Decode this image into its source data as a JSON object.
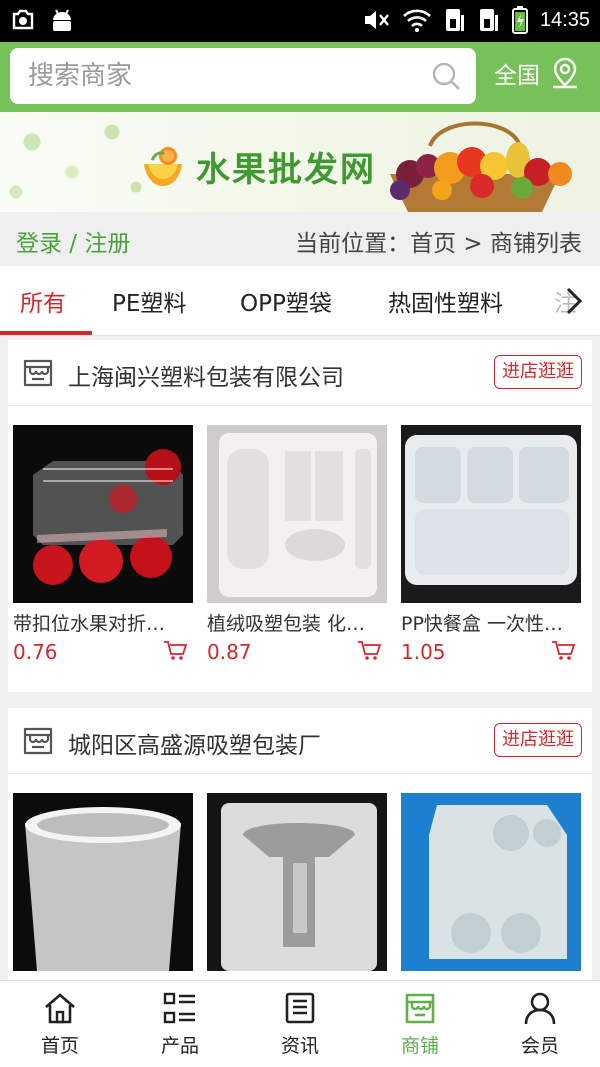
{
  "status_bar": {
    "time": "14:35"
  },
  "search": {
    "placeholder": "搜索商家"
  },
  "region": {
    "label": "全国"
  },
  "banner": {
    "title": "水果批发网"
  },
  "breadcrumb": {
    "login": "登录 / 注册",
    "location": "当前位置：首页 > 商铺列表"
  },
  "tabs": [
    {
      "label": "所有",
      "active": true
    },
    {
      "label": "PE塑料"
    },
    {
      "label": "OPP塑袋"
    },
    {
      "label": "热固性塑料"
    },
    {
      "label": "注"
    }
  ],
  "stores": [
    {
      "name": "上海闽兴塑料包装有限公司",
      "visit_label": "进店逛逛",
      "products": [
        {
          "name": "带扣位水果对折…",
          "price": "0.76"
        },
        {
          "name": "植绒吸塑包装 化…",
          "price": "0.87"
        },
        {
          "name": "PP快餐盒 一次性…",
          "price": "1.05"
        }
      ]
    },
    {
      "name": "城阳区高盛源吸塑包装厂",
      "visit_label": "进店逛逛",
      "products": [
        {
          "name": "",
          "price": ""
        },
        {
          "name": "",
          "price": ""
        },
        {
          "name": "",
          "price": ""
        }
      ]
    }
  ],
  "bottom_nav": [
    {
      "label": "首页",
      "icon": "home-icon"
    },
    {
      "label": "产品",
      "icon": "list-icon"
    },
    {
      "label": "资讯",
      "icon": "news-icon"
    },
    {
      "label": "商铺",
      "icon": "shop-icon",
      "active": true
    },
    {
      "label": "会员",
      "icon": "user-icon"
    }
  ],
  "colors": {
    "brand_green": "#77c15a",
    "accent_red": "#d6282c",
    "nav_active": "#5fb04b"
  }
}
